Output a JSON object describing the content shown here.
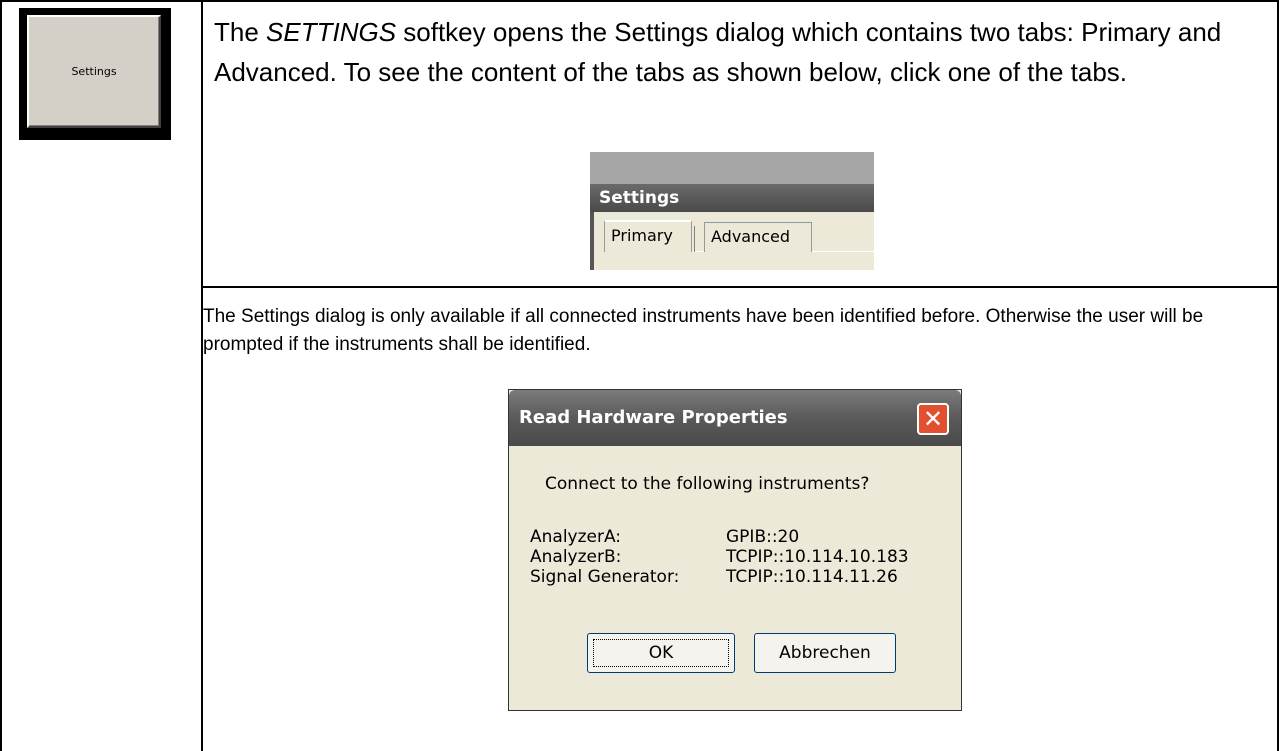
{
  "softkey": {
    "label": "Settings"
  },
  "intro": {
    "part1": "The ",
    "italic": "SETTINGS",
    "part2": " softkey opens the Settings dialog which contains two tabs: Primary and Advanced. To see the content of the tabs as shown below, click one of the tabs."
  },
  "settings_window": {
    "title": "Settings",
    "tabs": [
      "Primary",
      "Advanced"
    ]
  },
  "note": "The Settings dialog is only available if all connected instruments have been identified before. Otherwise the user will be prompted if the instruments shall be identified.",
  "dialog": {
    "title": "Read Hardware Properties",
    "close_icon": "✕",
    "question": "Connect to the following instruments?",
    "instruments": [
      {
        "name": "AnalyzerA:",
        "address": "GPIB::20"
      },
      {
        "name": "AnalyzerB:",
        "address": "TCPIP::10.114.10.183"
      },
      {
        "name": "Signal Generator:",
        "address": "TCPIP::10.114.11.26"
      }
    ],
    "ok_label": "OK",
    "cancel_label": "Abbrechen"
  }
}
